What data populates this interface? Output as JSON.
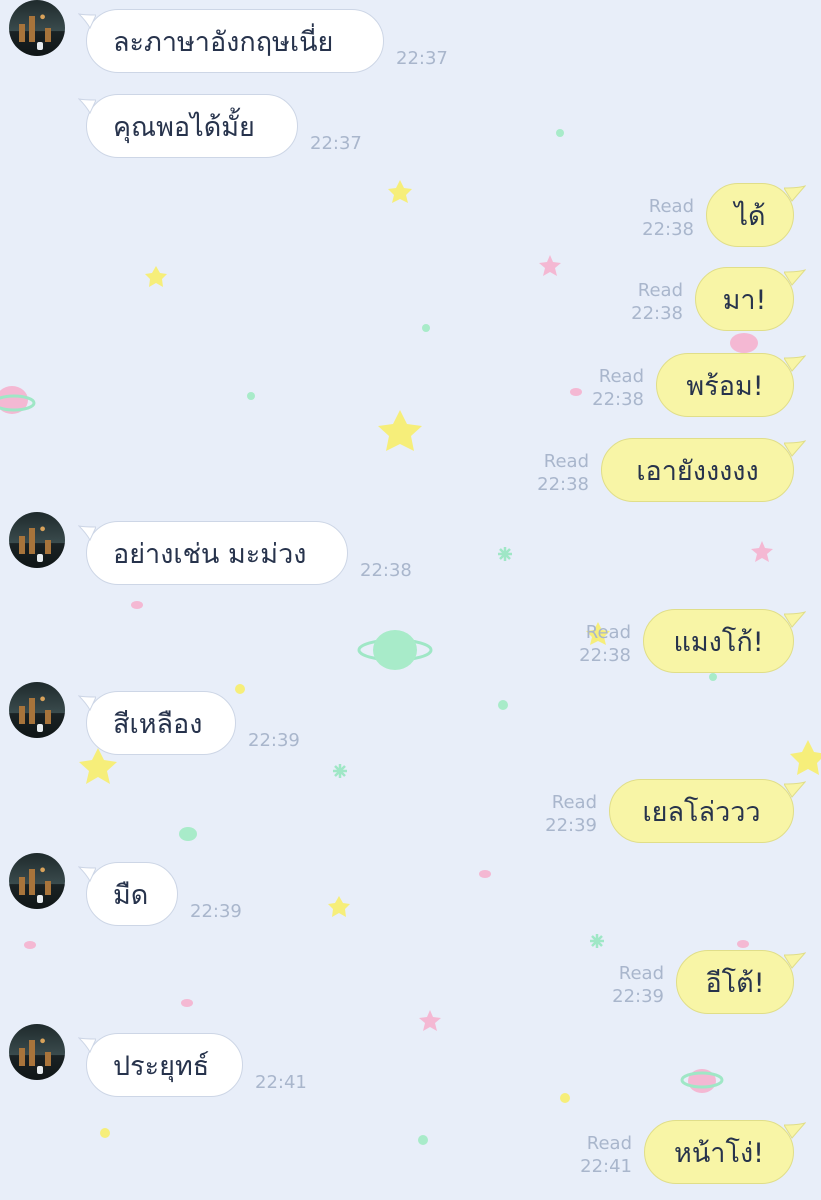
{
  "colors": {
    "background": "#e8eef9",
    "incoming_bubble": "#ffffff",
    "outgoing_bubble": "#f8f5a6",
    "text": "#27334c",
    "meta_text": "#a9b6cc"
  },
  "messages": [
    {
      "dir": "in",
      "text": "ละภาษาอังกฤษเนี่ย",
      "time": "22:37",
      "avatar": true
    },
    {
      "dir": "in",
      "text": "คุณพอได้มั้ย",
      "time": "22:37",
      "avatar": false
    },
    {
      "dir": "out",
      "text": "ได้",
      "time": "22:38",
      "read": "Read"
    },
    {
      "dir": "out",
      "text": "มา!",
      "time": "22:38",
      "read": "Read"
    },
    {
      "dir": "out",
      "text": "พร้อม!",
      "time": "22:38",
      "read": "Read"
    },
    {
      "dir": "out",
      "text": "เอายังงงงง",
      "time": "22:38",
      "read": "Read"
    },
    {
      "dir": "in",
      "text": "อย่างเช่น มะม่วง",
      "time": "22:38",
      "avatar": true
    },
    {
      "dir": "out",
      "text": "แมงโก้!",
      "time": "22:38",
      "read": "Read"
    },
    {
      "dir": "in",
      "text": "สีเหลือง",
      "time": "22:39",
      "avatar": true
    },
    {
      "dir": "out",
      "text": "เยลโล่ววว",
      "time": "22:39",
      "read": "Read"
    },
    {
      "dir": "in",
      "text": "มืด",
      "time": "22:39",
      "avatar": true
    },
    {
      "dir": "out",
      "text": "อีโต้!",
      "time": "22:39",
      "read": "Read"
    },
    {
      "dir": "in",
      "text": "ประยุทธ์",
      "time": "22:41",
      "avatar": true
    },
    {
      "dir": "out",
      "text": "หน้าโง่!",
      "time": "22:41",
      "read": "Read"
    }
  ]
}
